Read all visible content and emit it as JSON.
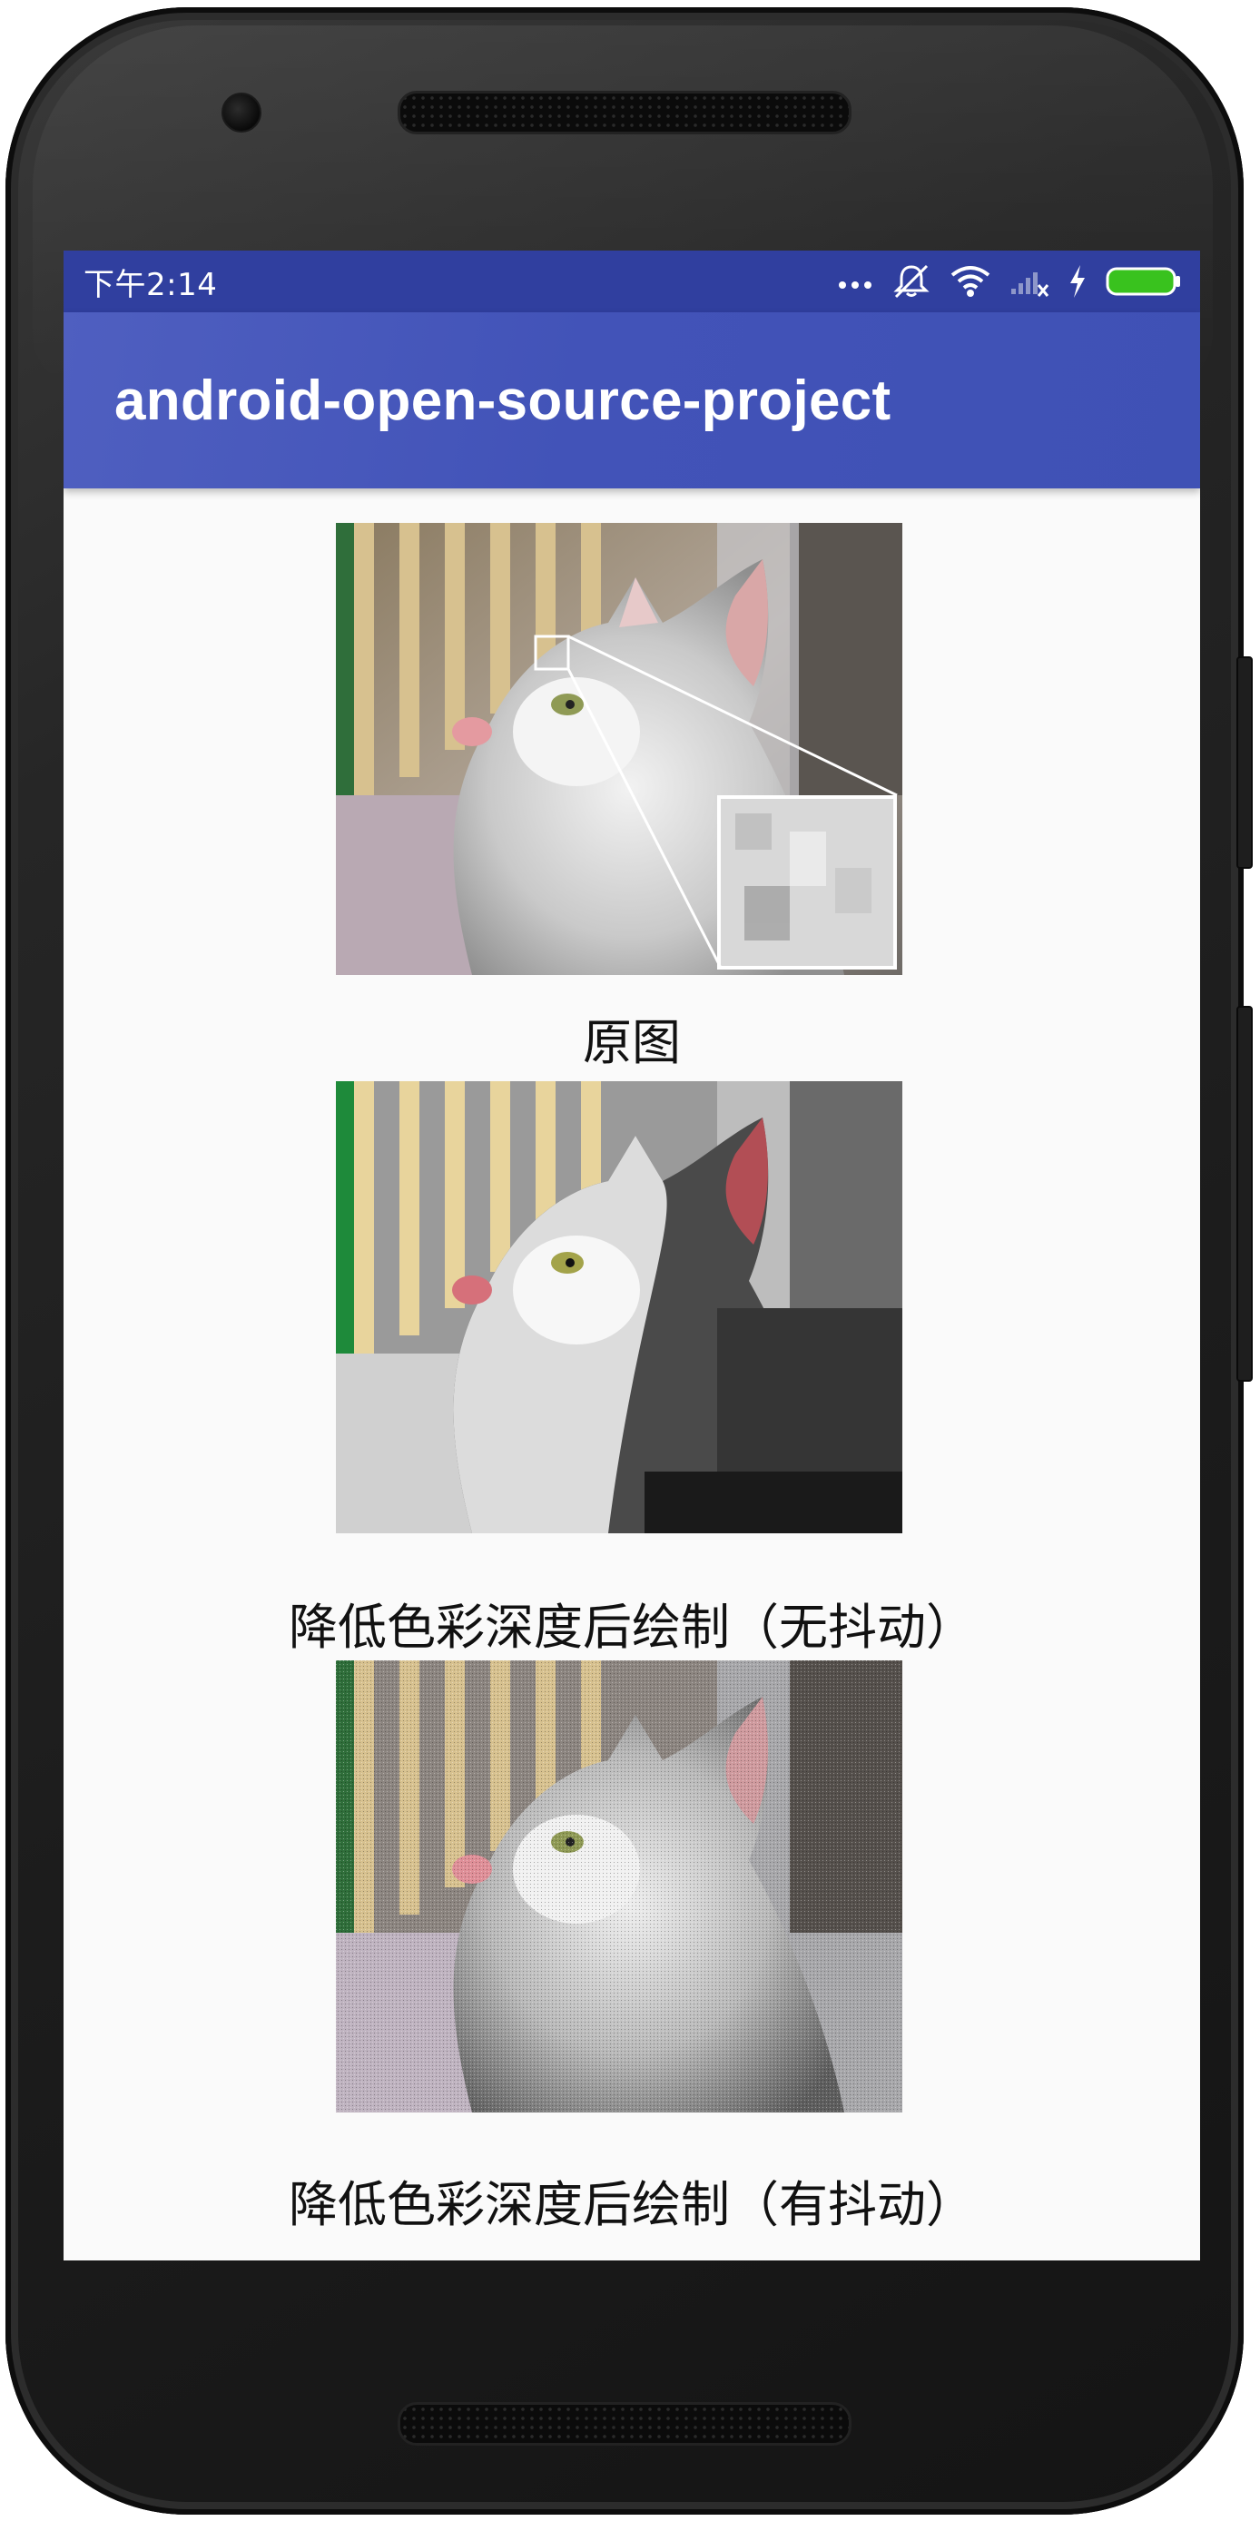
{
  "status_bar": {
    "time": "下午2:14",
    "icons": [
      "more-dots-icon",
      "vibrate-mute-icon",
      "wifi-icon",
      "signal-icon",
      "charging-bolt-icon",
      "battery-icon"
    ],
    "background": "#303f9f"
  },
  "app_bar": {
    "title": "android-open-source-project",
    "background": "#3f51b5"
  },
  "images": [
    {
      "caption": "原图",
      "variant": "original"
    },
    {
      "caption": "降低色彩深度后绘制（无抖动）",
      "variant": "reduced-no-dither"
    },
    {
      "caption": "降低色彩深度后绘制（有抖动）",
      "variant": "reduced-dither"
    }
  ],
  "colors": {
    "screen_background": "#fafafa",
    "caption_text": "#111111"
  }
}
